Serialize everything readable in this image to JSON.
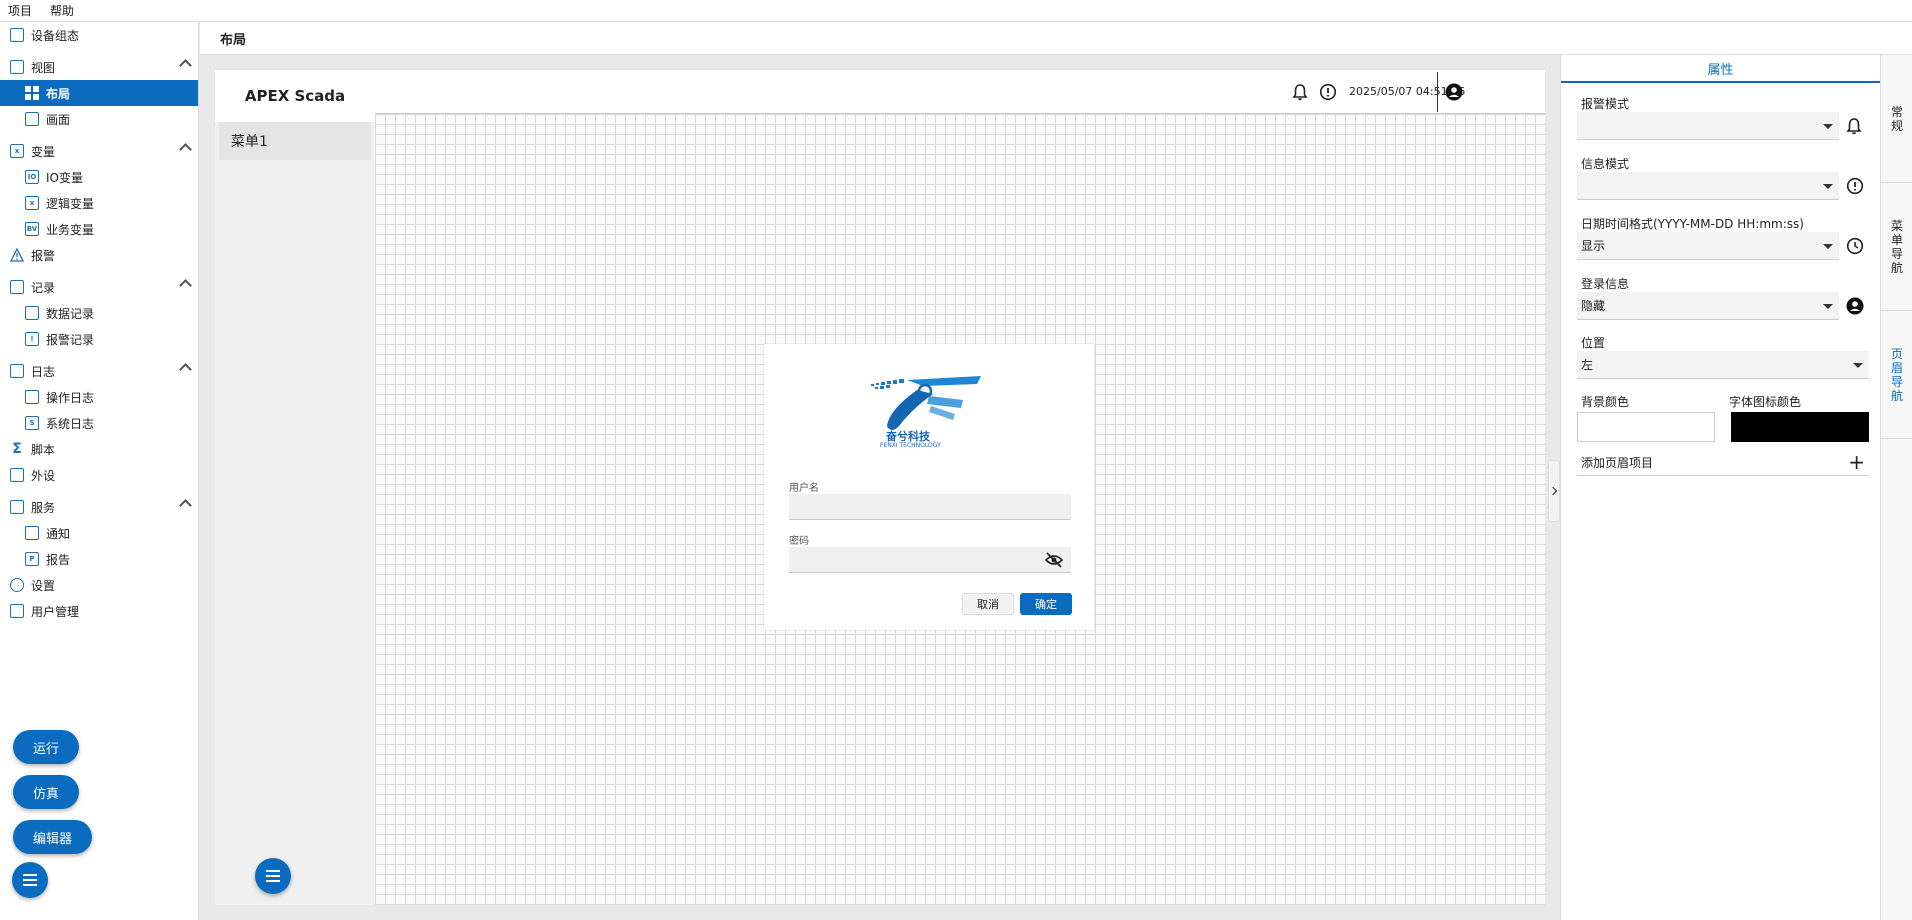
{
  "menubar": {
    "items": [
      "项目",
      "帮助"
    ]
  },
  "sidebar": {
    "items": [
      {
        "label": "设备组态",
        "icon": "device-config-icon"
      },
      {
        "label": "视图",
        "icon": "view-icon"
      },
      {
        "label": "布局",
        "icon": "layout-grid-icon"
      },
      {
        "label": "画面",
        "icon": "screen-icon"
      },
      {
        "label": "变量",
        "icon": "variable-icon"
      },
      {
        "label": "IO变量",
        "icon": "io-variable-icon"
      },
      {
        "label": "逻辑变量",
        "icon": "logic-variable-icon"
      },
      {
        "label": "业务变量",
        "icon": "business-variable-icon"
      },
      {
        "label": "报警",
        "icon": "alarm-warning-icon"
      },
      {
        "label": "记录",
        "icon": "record-icon"
      },
      {
        "label": "数据记录",
        "icon": "data-record-icon"
      },
      {
        "label": "报警记录",
        "icon": "alarm-record-icon"
      },
      {
        "label": "日志",
        "icon": "log-icon"
      },
      {
        "label": "操作日志",
        "icon": "operation-log-icon"
      },
      {
        "label": "系统日志",
        "icon": "system-log-icon"
      },
      {
        "label": "脚本",
        "icon": "script-sigma-icon"
      },
      {
        "label": "外设",
        "icon": "peripheral-icon"
      },
      {
        "label": "服务",
        "icon": "service-icon"
      },
      {
        "label": "通知",
        "icon": "notification-icon"
      },
      {
        "label": "报告",
        "icon": "report-icon"
      },
      {
        "label": "设置",
        "icon": "gear-icon"
      },
      {
        "label": "用户管理",
        "icon": "user-management-icon"
      }
    ],
    "buttons": {
      "run": "运行",
      "simulate": "仿真",
      "editor": "编辑器"
    }
  },
  "header": {
    "title": "布局"
  },
  "preview": {
    "brand": "APEX Scada",
    "menu_item": "菜单1",
    "datetime": "2025/05/07 04:51:46",
    "login": {
      "logo_text": "奋兮科技",
      "logo_subtext": "FENXI TECHNOLOGY",
      "username_label": "用户名",
      "password_label": "密码",
      "cancel": "取消",
      "ok": "确定"
    }
  },
  "properties": {
    "title": "属性",
    "alarm_mode_label": "报警模式",
    "alarm_mode_value": "",
    "info_mode_label": "信息模式",
    "info_mode_value": "",
    "datetime_format_label": "日期时间格式(YYYY-MM-DD HH:mm:ss)",
    "datetime_format_value": "显示",
    "login_info_label": "登录信息",
    "login_info_value": "隐藏",
    "position_label": "位置",
    "position_value": "左",
    "bg_color_label": "背景颜色",
    "bg_color": "#ffffff",
    "font_icon_color_label": "字体图标颜色",
    "font_icon_color": "#000000",
    "add_header_item": "添加页眉项目"
  },
  "rail": {
    "tabs": [
      {
        "label": "常规",
        "active": false
      },
      {
        "label": "菜单导航",
        "active": false
      },
      {
        "label": "页眉导航",
        "active": true
      }
    ]
  },
  "colors": {
    "accent": "#0b6cbf"
  }
}
